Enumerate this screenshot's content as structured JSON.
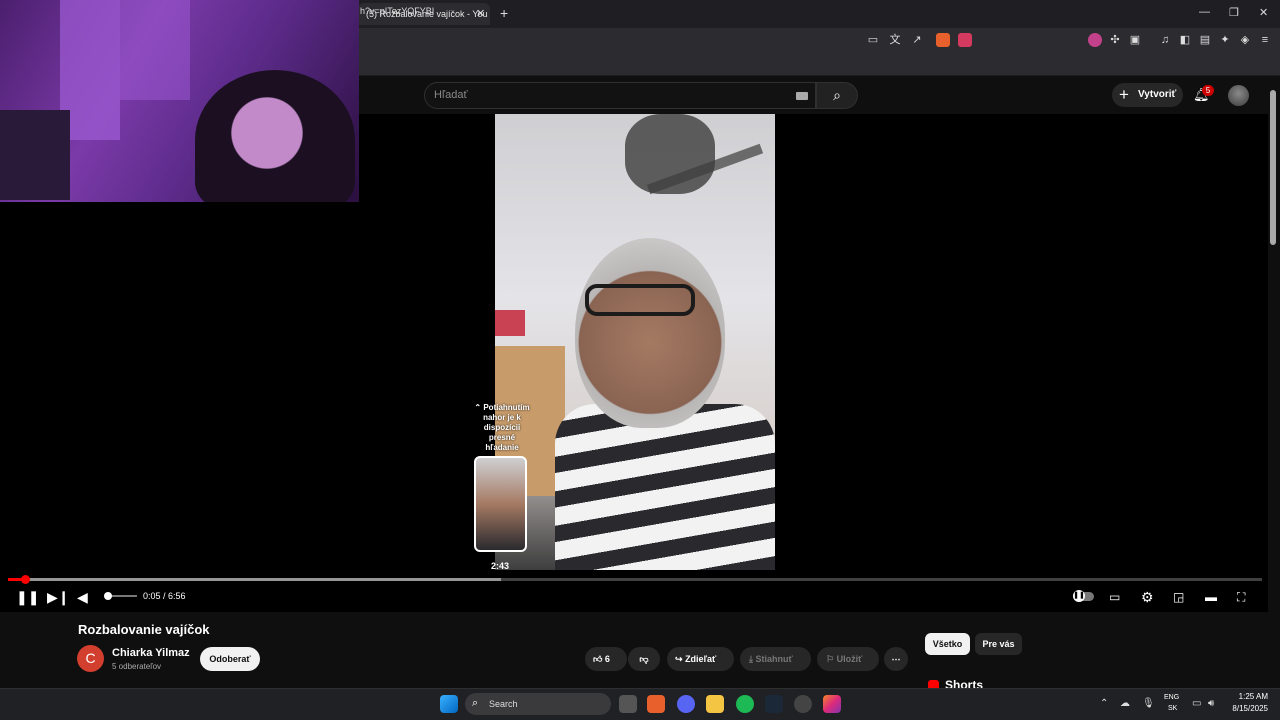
{
  "browser": {
    "tab_title": "(5) Rozbalovanie vajíčok - You",
    "tab_close": "✕",
    "new_tab": "+",
    "url": "h?v=pITezYQFYBI",
    "window_controls": [
      "—",
      "❐",
      "✕"
    ]
  },
  "youtube": {
    "search_placeholder": "Hľadať",
    "create_label": "Vytvoriť",
    "notification_count": "5"
  },
  "player": {
    "seek_tooltip": "⌃ Potiahnutím nahor je k dispozícii presné hľadanie",
    "seek_time": "2:43",
    "time_display": "0:05 / 6:56",
    "progress_played_fraction": 0.0144,
    "progress_buffered_fraction": 0.3929
  },
  "video": {
    "title": "Rozbalovanie vajíčok",
    "channel_name": "Chiarka Yilmaz",
    "channel_initial": "C",
    "subscribers": "5 odberateľov",
    "subscribe_label": "Odoberať",
    "likes": "6",
    "share_label": "Zdieľať",
    "download_label": "Stiahnuť",
    "save_label": "Uložiť"
  },
  "sidebar": {
    "filter_all": "Všetko",
    "filter_foryou": "Pre vás",
    "shorts_label": "Shorts"
  },
  "taskbar": {
    "search_label": "Search",
    "lang_1": "ENG",
    "lang_2": "SK",
    "time": "1:25 AM",
    "date": "8/15/2025"
  },
  "colors": {
    "accent": "#ff0000",
    "background": "#0f0f0f"
  }
}
